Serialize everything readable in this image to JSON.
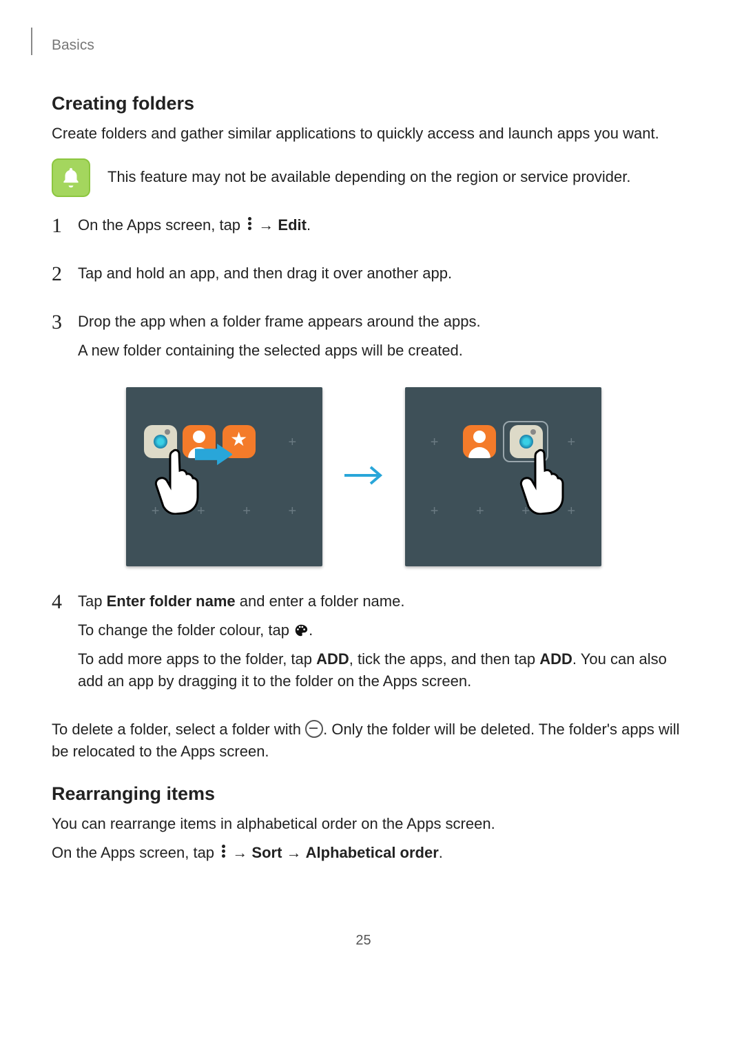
{
  "breadcrumb": "Basics",
  "section1": {
    "title": "Creating folders",
    "intro": "Create folders and gather similar applications to quickly access and launch apps you want.",
    "note": "This feature may not be available depending on the region or service provider.",
    "step1_a": "On the Apps screen, tap ",
    "step1_b": " → ",
    "step1_edit": "Edit",
    "step1_c": ".",
    "step2": "Tap and hold an app, and then drag it over another app.",
    "step3_a": "Drop the app when a folder frame appears around the apps.",
    "step3_b": "A new folder containing the selected apps will be created.",
    "step4_a": "Tap ",
    "step4_enter": "Enter folder name",
    "step4_b": " and enter a folder name.",
    "step4_c": "To change the folder colour, tap ",
    "step4_d": ".",
    "step4_e": "To add more apps to the folder, tap ",
    "step4_add": "ADD",
    "step4_f": ", tick the apps, and then tap ",
    "step4_g": ". You can also add an app by dragging it to the folder on the Apps screen.",
    "delete_a": "To delete a folder, select a folder with ",
    "delete_b": ". Only the folder will be deleted. The folder's apps will be relocated to the Apps screen."
  },
  "section2": {
    "title": "Rearranging items",
    "intro": "You can rearrange items in alphabetical order on the Apps screen.",
    "line_a": "On the Apps screen, tap ",
    "line_b": " → ",
    "sort": "Sort",
    "line_c": " → ",
    "alpha": "Alphabetical order",
    "line_d": "."
  },
  "page_number": "25"
}
